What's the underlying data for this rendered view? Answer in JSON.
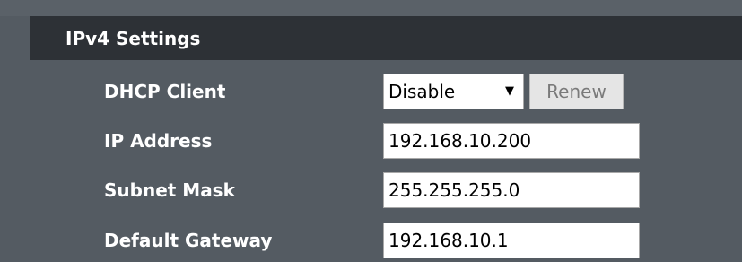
{
  "section": {
    "title": "IPv4 Settings"
  },
  "fields": {
    "dhcp_client": {
      "label": "DHCP Client",
      "value": "Disable",
      "renew_label": "Renew"
    },
    "ip_address": {
      "label": "IP Address",
      "value": "192.168.10.200"
    },
    "subnet_mask": {
      "label": "Subnet Mask",
      "value": "255.255.255.0"
    },
    "default_gateway": {
      "label": "Default Gateway",
      "value": "192.168.10.1"
    }
  },
  "icons": {
    "dropdown_arrow": "chevron-down-icon"
  },
  "colors": {
    "background": "#545b62",
    "header_bar": "#2d3136",
    "label_text": "#ffffff",
    "button_disabled_text": "#7a7a7a"
  }
}
